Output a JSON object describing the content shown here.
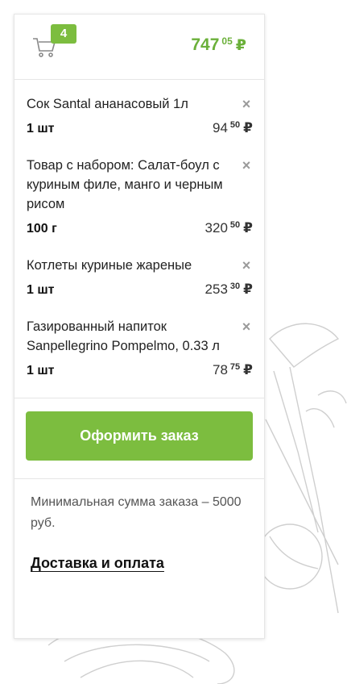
{
  "cart": {
    "badge_count": "4",
    "total_int": "747",
    "total_frac": "05",
    "currency": "₽"
  },
  "items": [
    {
      "name": "Сок Santal ананасовый 1л",
      "qty": "1 шт",
      "price_int": "94",
      "price_frac": "50",
      "currency": "₽"
    },
    {
      "name": "Товар с набором: Салат-боул с куриным филе, манго и черным рисом",
      "qty": "100 г",
      "price_int": "320",
      "price_frac": "50",
      "currency": "₽"
    },
    {
      "name": "Котлеты куриные жареные",
      "qty": "1 шт",
      "price_int": "253",
      "price_frac": "30",
      "currency": "₽"
    },
    {
      "name": "Газированный напиток Sanpellegrino Pompelmo, 0.33 л",
      "qty": "1 шт",
      "price_int": "78",
      "price_frac": "75",
      "currency": "₽"
    }
  ],
  "actions": {
    "order_label": "Оформить заказ",
    "remove_icon": "close-icon"
  },
  "footer": {
    "min_order_text": "Минимальная сумма заказа – 5000 руб.",
    "delivery_link": "Доставка и оплата"
  },
  "colors": {
    "accent": "#7cbd3f",
    "total_text": "#6bb03a"
  }
}
